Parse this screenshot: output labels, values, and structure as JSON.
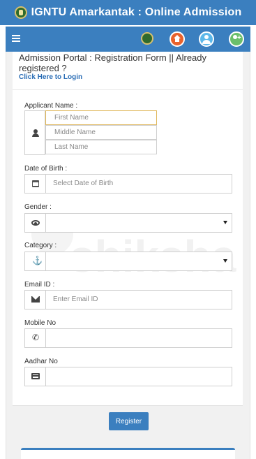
{
  "header": {
    "title": "IGNTU Amarkantak : Online Admission"
  },
  "navbar": {
    "icons": [
      "menu-icon",
      "university-logo-icon",
      "home-icon",
      "user-icon",
      "add-user-icon"
    ]
  },
  "page": {
    "heading": "Admission Portal : Registration Form || Already registered ?",
    "login_link": "Click Here to Login"
  },
  "form": {
    "applicant_name": {
      "label": "Applicant Name :",
      "first_placeholder": "First Name",
      "middle_placeholder": "Middle Name",
      "last_placeholder": "Last Name"
    },
    "dob": {
      "label": "Date of Birth :",
      "placeholder": "Select Date of Birth"
    },
    "gender": {
      "label": "Gender :",
      "value": ""
    },
    "category": {
      "label": "Category :",
      "value": ""
    },
    "email": {
      "label": "Email ID :",
      "placeholder": "Enter Email ID"
    },
    "mobile": {
      "label": "Mobile No",
      "value": ""
    },
    "aadhar": {
      "label": "Aadhar No",
      "value": ""
    },
    "register_label": "Register"
  },
  "watermark": {
    "text": "shiksha"
  },
  "colors": {
    "primary": "#3b7fbf",
    "focus_border": "#e0b75a",
    "link": "#2a6db5"
  }
}
